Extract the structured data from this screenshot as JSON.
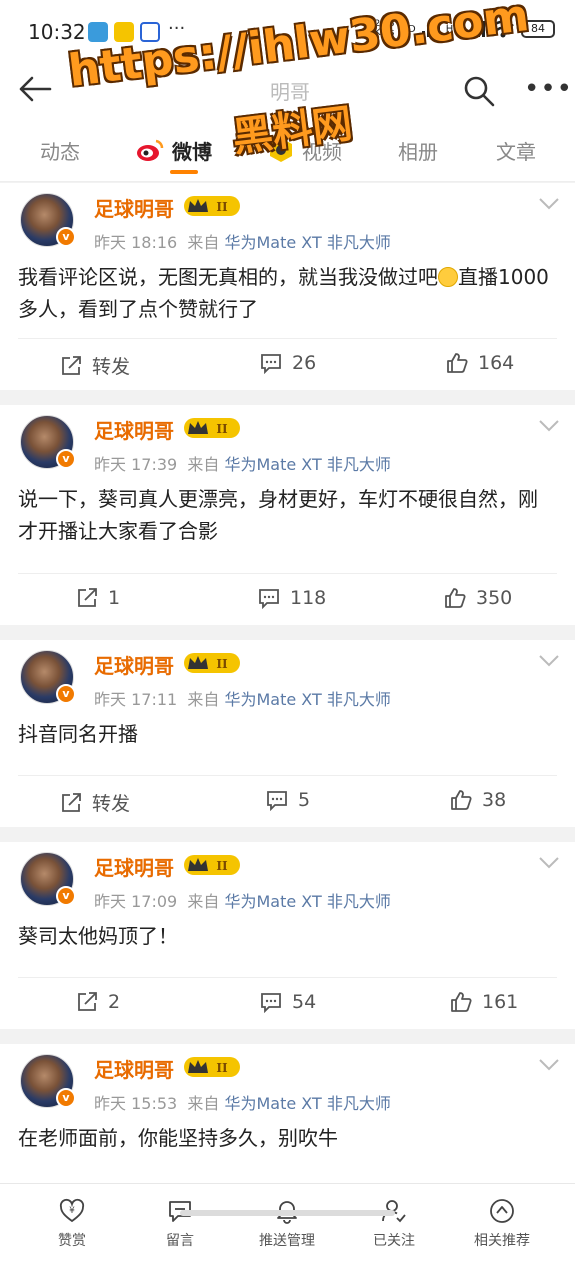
{
  "status_bar": {
    "time": "10:32",
    "net_speed": "2.78",
    "net_unit": "KB/s",
    "signal1": "HD",
    "signal2": "HD",
    "battery": "84"
  },
  "header": {
    "title": "明哥"
  },
  "watermark": {
    "line1": "https://ihlw30.com",
    "line2": "黑料网"
  },
  "tabs": [
    {
      "label": "动态"
    },
    {
      "label": "微博"
    },
    {
      "label": "视频"
    },
    {
      "label": "相册"
    },
    {
      "label": "文章"
    }
  ],
  "posts": [
    {
      "author": "足球明哥",
      "level": "II",
      "time": "昨天 18:16",
      "source_prefix": "来自",
      "source": "华为Mate XT 非凡大师",
      "text": "我看评论区说，无图无真相的，就当我没做过吧",
      "text_after_emoji": "直播1000多人，看到了点个赞就行了",
      "repost": "转发",
      "comments": "26",
      "likes": "164"
    },
    {
      "author": "足球明哥",
      "level": "II",
      "time": "昨天 17:39",
      "source_prefix": "来自",
      "source": "华为Mate XT 非凡大师",
      "text": "说一下，葵司真人更漂亮，身材更好，车灯不硬很自然，刚才开播让大家看了合影",
      "repost": "1",
      "comments": "118",
      "likes": "350"
    },
    {
      "author": "足球明哥",
      "level": "II",
      "time": "昨天 17:11",
      "source_prefix": "来自",
      "source": "华为Mate XT 非凡大师",
      "text": "抖音同名开播",
      "repost": "转发",
      "comments": "5",
      "likes": "38"
    },
    {
      "author": "足球明哥",
      "level": "II",
      "time": "昨天 17:09",
      "source_prefix": "来自",
      "source": "华为Mate XT 非凡大师",
      "text": "葵司太他妈顶了！",
      "repost": "2",
      "comments": "54",
      "likes": "161"
    },
    {
      "author": "足球明哥",
      "level": "II",
      "time": "昨天 15:53",
      "source_prefix": "来自",
      "source": "华为Mate XT 非凡大师",
      "text": "在老师面前，你能坚持多久，别吹牛"
    }
  ],
  "bottom_bar": [
    {
      "label": "赞赏",
      "icon": "reward-heart-icon"
    },
    {
      "label": "留言",
      "icon": "message-icon"
    },
    {
      "label": "推送管理",
      "icon": "bell-icon"
    },
    {
      "label": "已关注",
      "icon": "user-check-icon"
    },
    {
      "label": "相关推荐",
      "icon": "compass-icon"
    }
  ],
  "colors": {
    "accent": "#ff8200",
    "author": "#e86b00",
    "source_link": "#5b7aa6"
  }
}
